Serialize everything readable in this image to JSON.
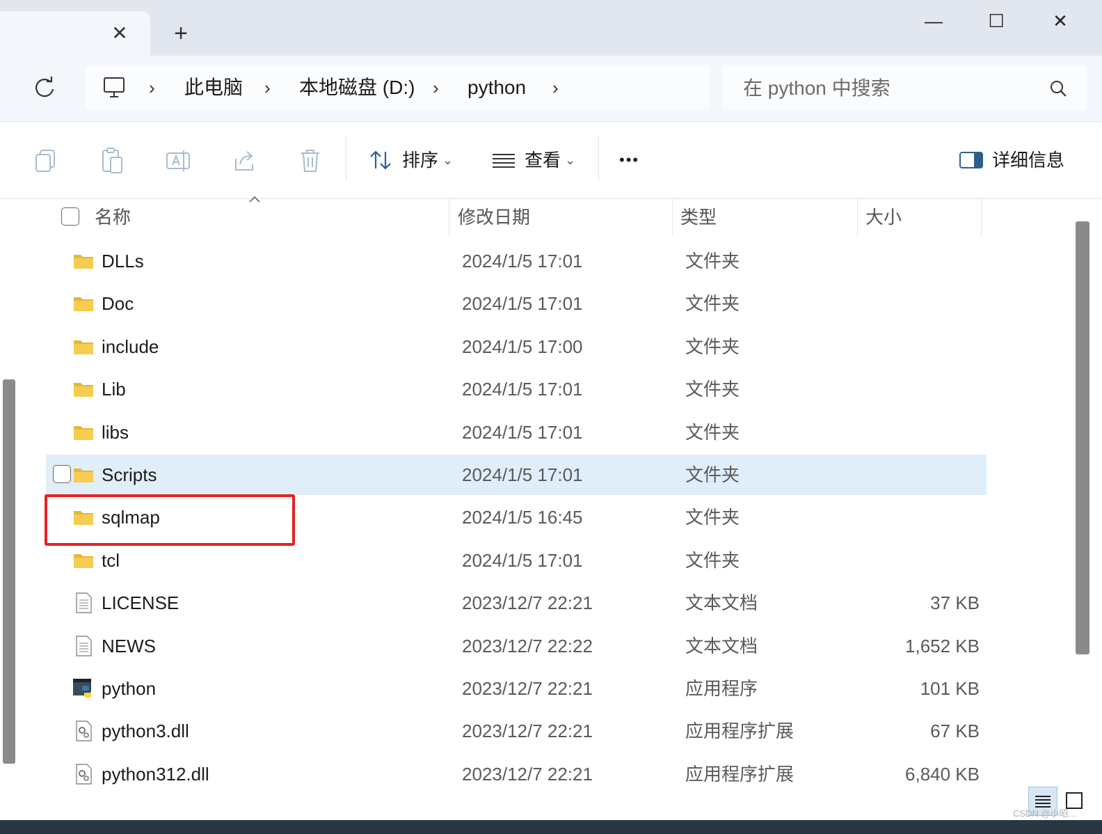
{
  "tab": {
    "close_symbol": "✕",
    "new_tab_symbol": "+"
  },
  "window_controls": {
    "minimize": "—",
    "maximize": "☐",
    "close": "✕"
  },
  "breadcrumb": {
    "items": [
      "此电脑",
      "本地磁盘 (D:)",
      "python"
    ],
    "separator": "›"
  },
  "search": {
    "placeholder": "在 python 中搜索"
  },
  "toolbar": {
    "sort_label": "排序",
    "view_label": "查看",
    "more_label": "•••",
    "details_label": "详细信息",
    "chevron": "⌄"
  },
  "columns": {
    "name": "名称",
    "date": "修改日期",
    "type": "类型",
    "size": "大小"
  },
  "files": [
    {
      "name": "DLLs",
      "date": "2024/1/5 17:01",
      "type": "文件夹",
      "size": "",
      "icon": "folder-icon"
    },
    {
      "name": "Doc",
      "date": "2024/1/5 17:01",
      "type": "文件夹",
      "size": "",
      "icon": "folder-icon"
    },
    {
      "name": "include",
      "date": "2024/1/5 17:00",
      "type": "文件夹",
      "size": "",
      "icon": "folder-icon"
    },
    {
      "name": "Lib",
      "date": "2024/1/5 17:01",
      "type": "文件夹",
      "size": "",
      "icon": "folder-icon"
    },
    {
      "name": "libs",
      "date": "2024/1/5 17:01",
      "type": "文件夹",
      "size": "",
      "icon": "folder-icon"
    },
    {
      "name": "Scripts",
      "date": "2024/1/5 17:01",
      "type": "文件夹",
      "size": "",
      "icon": "folder-icon"
    },
    {
      "name": "sqlmap",
      "date": "2024/1/5 16:45",
      "type": "文件夹",
      "size": "",
      "icon": "folder-icon"
    },
    {
      "name": "tcl",
      "date": "2024/1/5 17:01",
      "type": "文件夹",
      "size": "",
      "icon": "folder-icon"
    },
    {
      "name": "LICENSE",
      "date": "2023/12/7 22:21",
      "type": "文本文档",
      "size": "37 KB",
      "icon": "text-file-icon"
    },
    {
      "name": "NEWS",
      "date": "2023/12/7 22:22",
      "type": "文本文档",
      "size": "1,652 KB",
      "icon": "text-file-icon"
    },
    {
      "name": "python",
      "date": "2023/12/7 22:21",
      "type": "应用程序",
      "size": "101 KB",
      "icon": "python-exe-icon"
    },
    {
      "name": "python3.dll",
      "date": "2023/12/7 22:21",
      "type": "应用程序扩展",
      "size": "67 KB",
      "icon": "dll-file-icon"
    },
    {
      "name": "python312.dll",
      "date": "2023/12/7 22:21",
      "type": "应用程序扩展",
      "size": "6,840 KB",
      "icon": "dll-file-icon"
    }
  ],
  "hovered_row": "Scripts",
  "highlighted_row": "sqlmap",
  "colors": {
    "accent": "#0067c0",
    "selection": "#e0eef9",
    "highlight_border": "#e8211f",
    "folder": "#f4c74a"
  },
  "watermark": "CSDN @小昭..."
}
